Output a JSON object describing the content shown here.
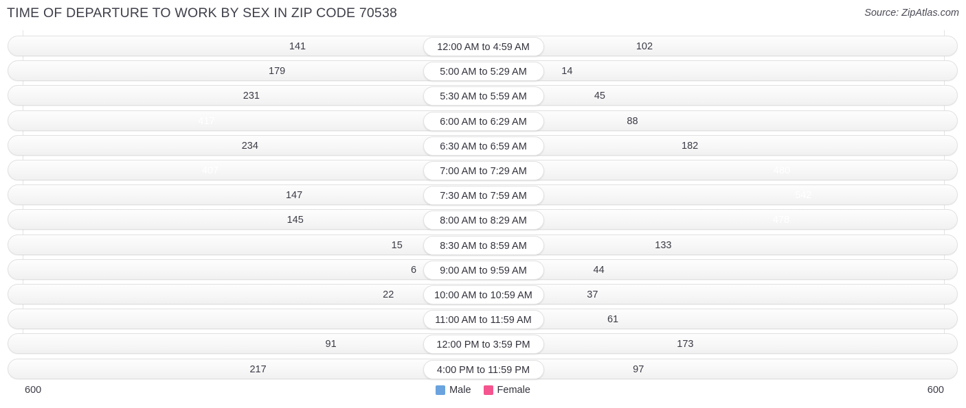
{
  "header": {
    "title": "TIME OF DEPARTURE TO WORK BY SEX IN ZIP CODE 70538",
    "source": "Source: ZipAtlas.com"
  },
  "footer": {
    "axis_left": "600",
    "axis_right": "600",
    "legend": [
      {
        "label": "Male",
        "color": "#6aa3de"
      },
      {
        "label": "Female",
        "color": "#f4558f"
      }
    ]
  },
  "colors": {
    "male_light": "#8fbce8",
    "male_dark": "#5b9bd8",
    "female_light": "#f9a8c2",
    "female_mid": "#f58fb4",
    "female_dark": "#f56a9c",
    "female_darkest": "#f2508b",
    "track": "#f5f5f5",
    "grid": "#e3e3e3",
    "text": "#3b3b46"
  },
  "chart_data": {
    "type": "bar",
    "orientation": "horizontal-diverging",
    "title": "TIME OF DEPARTURE TO WORK BY SEX IN ZIP CODE 70538",
    "xlabel": "",
    "ylabel": "",
    "axis_max": 600,
    "xlim": [
      600,
      600
    ],
    "grid": true,
    "legend_position": "bottom-center",
    "categories": [
      "12:00 AM to 4:59 AM",
      "5:00 AM to 5:29 AM",
      "5:30 AM to 5:59 AM",
      "6:00 AM to 6:29 AM",
      "6:30 AM to 6:59 AM",
      "7:00 AM to 7:29 AM",
      "7:30 AM to 7:59 AM",
      "8:00 AM to 8:29 AM",
      "8:30 AM to 8:59 AM",
      "9:00 AM to 9:59 AM",
      "10:00 AM to 10:59 AM",
      "11:00 AM to 11:59 AM",
      "12:00 PM to 3:59 PM",
      "4:00 PM to 11:59 PM"
    ],
    "series": [
      {
        "name": "Male",
        "side": "left",
        "color": "#6aa3de",
        "values": [
          141,
          179,
          231,
          417,
          234,
          407,
          147,
          145,
          15,
          6,
          22,
          0,
          91,
          217
        ]
      },
      {
        "name": "Female",
        "side": "right",
        "color": "#f4558f",
        "values": [
          102,
          14,
          45,
          88,
          182,
          480,
          542,
          478,
          133,
          44,
          37,
          61,
          173,
          97
        ]
      }
    ]
  }
}
